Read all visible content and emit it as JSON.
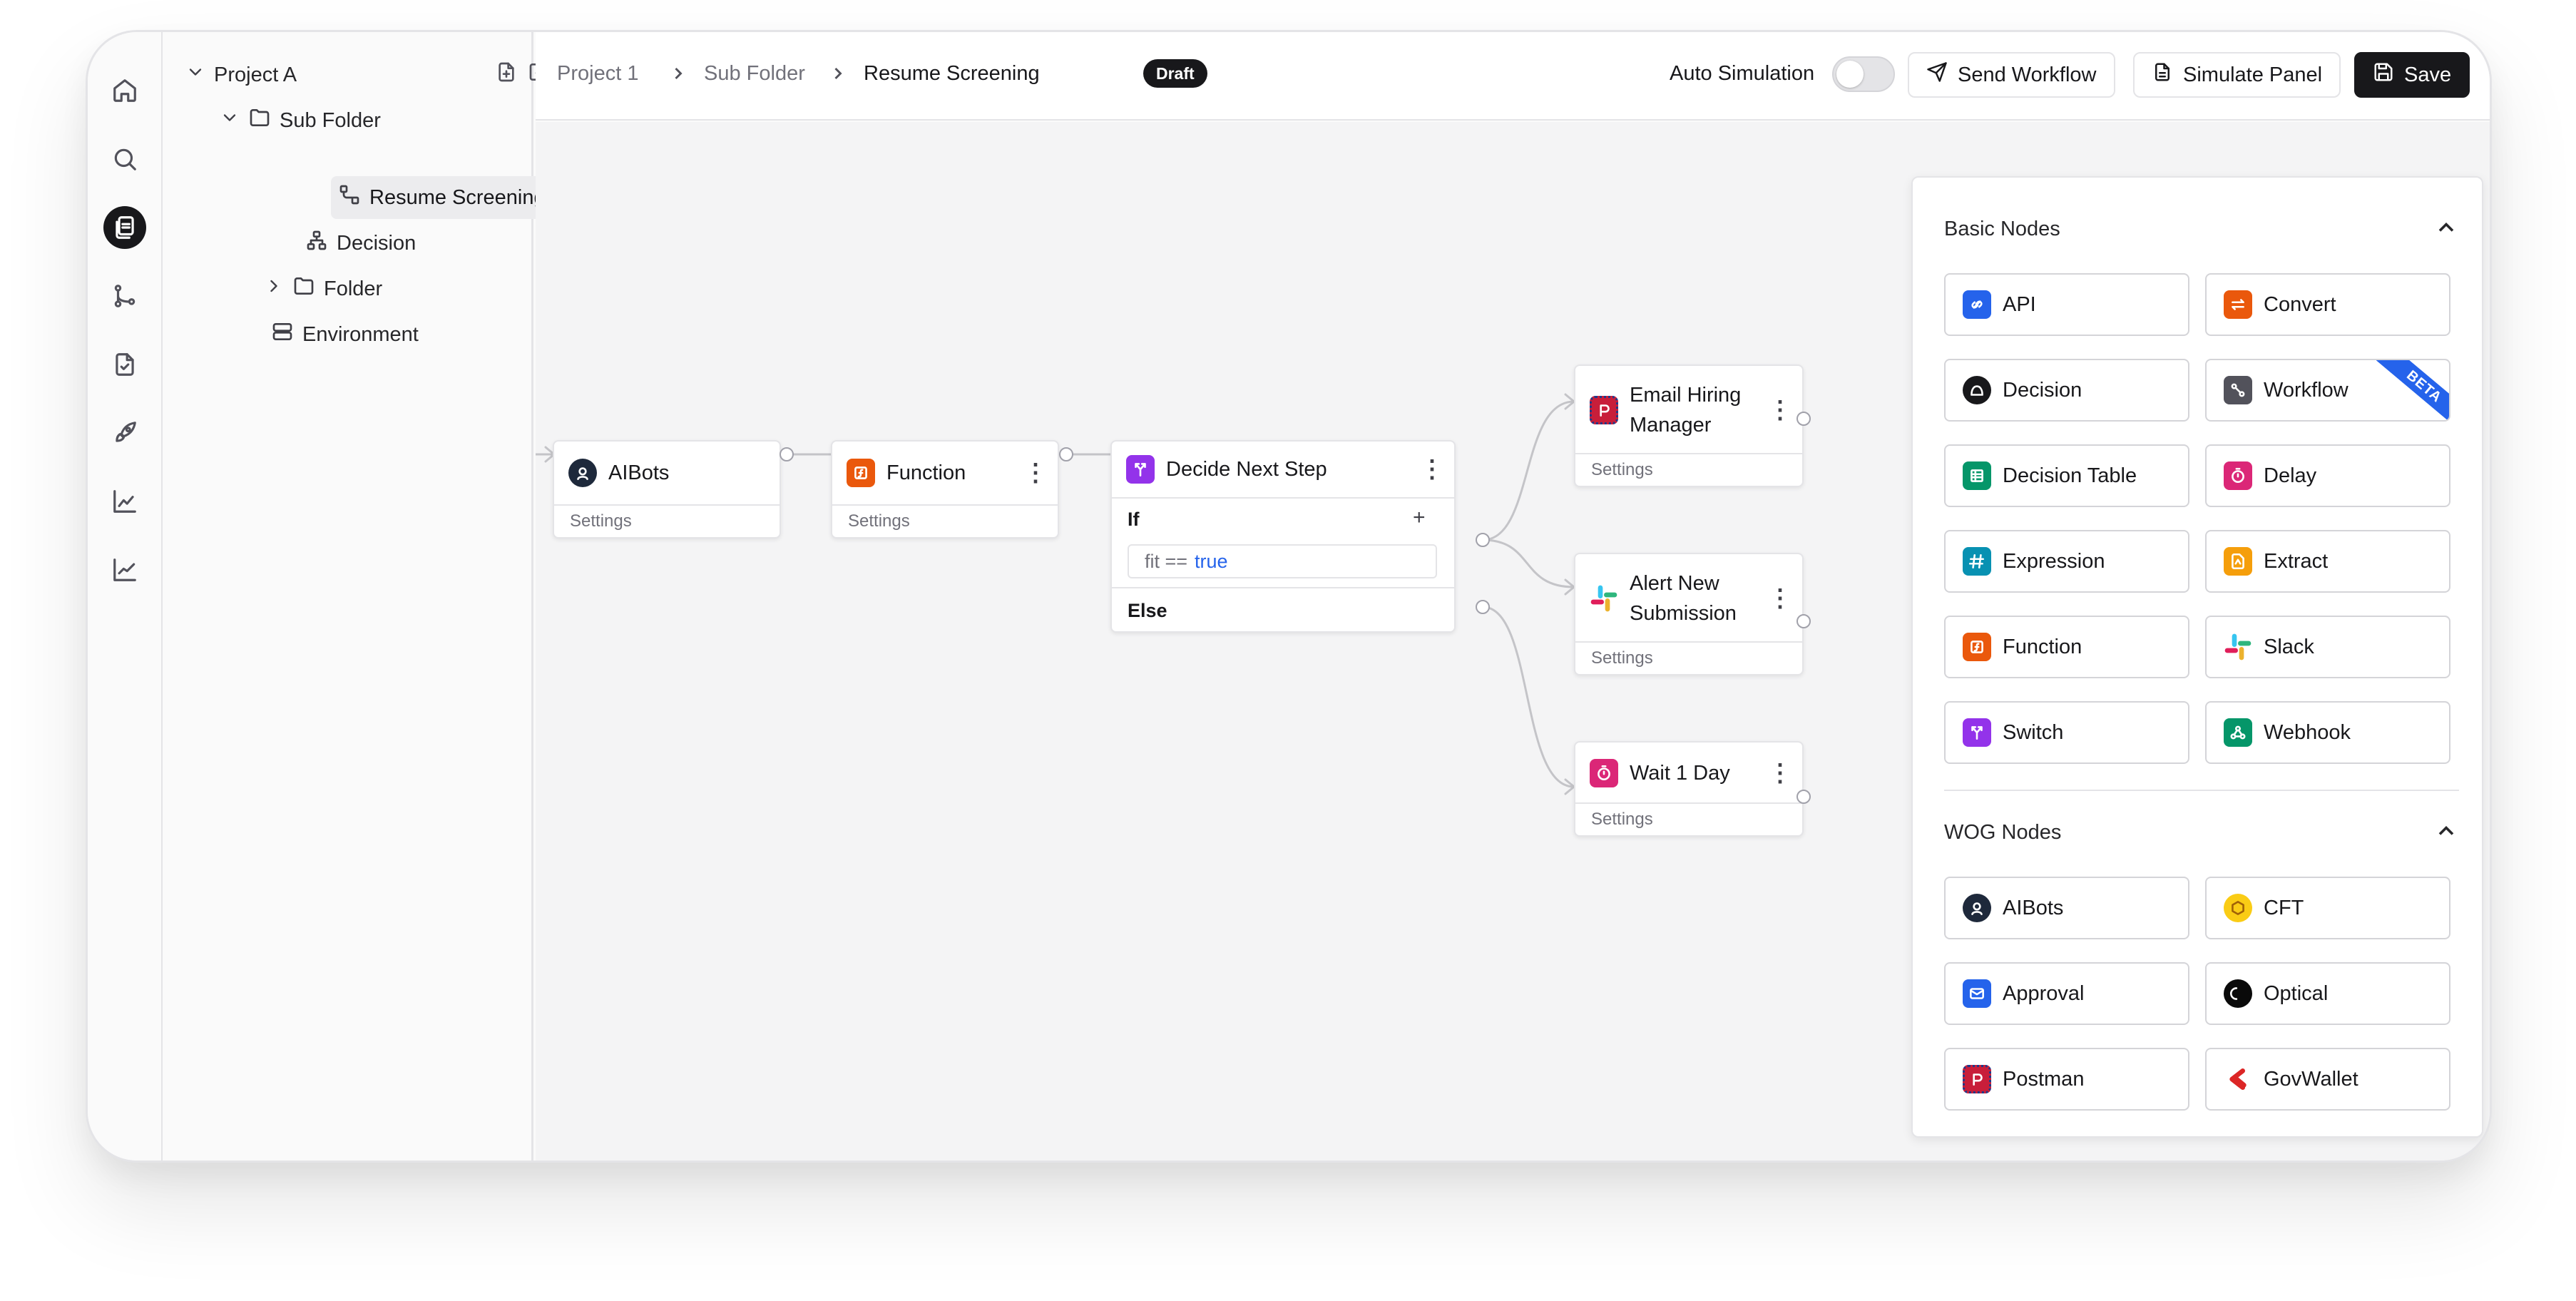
{
  "rail": {
    "items": [
      {
        "icon": "home-icon"
      },
      {
        "icon": "search-icon"
      },
      {
        "icon": "files-icon",
        "active": true
      },
      {
        "icon": "git-branch-icon"
      },
      {
        "icon": "file-check-icon"
      },
      {
        "icon": "rocket-icon"
      },
      {
        "icon": "bar-chart-icon"
      },
      {
        "icon": "line-chart-icon"
      }
    ]
  },
  "tree": {
    "project": "Project A",
    "sub_folder": "Sub Folder",
    "resume_screening": "Resume Screening",
    "decision": "Decision",
    "folder": "Folder",
    "environment": "Environment"
  },
  "breadcrumb": {
    "project": "Project 1",
    "folder": "Sub Folder",
    "current": "Resume Screening",
    "badge": "Draft"
  },
  "topbar": {
    "auto_simulation": "Auto Simulation",
    "auto_simulation_on": false,
    "send_workflow": "Send Workflow",
    "simulate_panel": "Simulate Panel",
    "save": "Save"
  },
  "nodes": {
    "settings_label": "Settings",
    "aibots": "AIBots",
    "function": "Function",
    "decide": {
      "title": "Decide Next Step",
      "if_label": "If",
      "condition_var": "fit ==",
      "condition_val": "true",
      "add": "+",
      "else_label": "Else"
    },
    "email_line1": "Email Hiring",
    "email_line2": "Manager",
    "alert_line1": "Alert New",
    "alert_line2": "Submission",
    "wait": "Wait 1 Day"
  },
  "palette": {
    "basic_title": "Basic Nodes",
    "basic": [
      {
        "label": "API",
        "color": "#2563eb"
      },
      {
        "label": "Convert",
        "color": "#ea580c"
      },
      {
        "label": "Decision",
        "color": "#18181b"
      },
      {
        "label": "Workflow",
        "color": "#52525b",
        "badge": "BETA"
      },
      {
        "label": "Decision Table",
        "color": "#059669"
      },
      {
        "label": "Delay",
        "color": "#db2777"
      },
      {
        "label": "Expression",
        "color": "#0891b2"
      },
      {
        "label": "Extract",
        "color": "#f59e0b"
      },
      {
        "label": "Function",
        "color": "#ea580c"
      },
      {
        "label": "Slack",
        "color": "#e11d48"
      },
      {
        "label": "Switch",
        "color": "#9333ea"
      },
      {
        "label": "Webhook",
        "color": "#059669"
      }
    ],
    "wog_title": "WOG Nodes",
    "wog": [
      {
        "label": "AIBots",
        "color": "#1e293b"
      },
      {
        "label": "CFT",
        "color": "#facc15"
      },
      {
        "label": "Approval",
        "color": "#2563eb"
      },
      {
        "label": "Optical",
        "color": "#0a0a0a"
      },
      {
        "label": "Postman",
        "color": "#c81e3a"
      },
      {
        "label": "GovWallet",
        "color": "#dc2626"
      }
    ]
  },
  "toolbar": {
    "tools": [
      "upload-icon",
      "download-icon",
      "add-node-icon",
      "zoom-in-icon",
      "zoom-out-icon",
      "fit-view-icon",
      "lock-icon",
      "layout-icon"
    ]
  }
}
